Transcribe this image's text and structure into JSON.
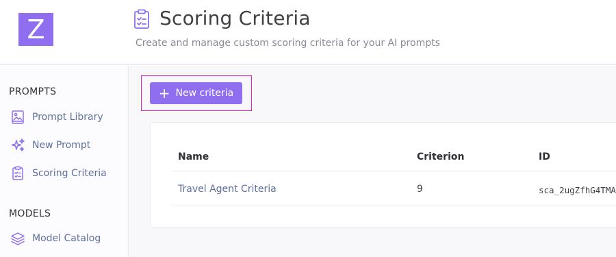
{
  "header": {
    "logo_letter": "Z",
    "title": "Scoring Criteria",
    "subtitle": "Create and manage custom scoring criteria for your AI prompts",
    "title_icon": "clipboard-list-icon"
  },
  "sidebar": {
    "sections": [
      {
        "title": "PROMPTS",
        "items": [
          {
            "label": "Prompt Library",
            "icon": "image-book-icon"
          },
          {
            "label": "New Prompt",
            "icon": "sparkles-icon"
          },
          {
            "label": "Scoring Criteria",
            "icon": "clipboard-list-icon"
          }
        ]
      },
      {
        "title": "MODELS",
        "items": [
          {
            "label": "Model Catalog",
            "icon": "layers-icon"
          }
        ]
      }
    ]
  },
  "main": {
    "new_button_label": "New criteria",
    "table": {
      "columns": [
        "Name",
        "Criterion",
        "ID"
      ],
      "rows": [
        {
          "name": "Travel Agent Criteria",
          "criterion": "9",
          "id": "sca_2ugZfhG4TMA"
        }
      ]
    }
  },
  "colors": {
    "accent": "#8f6ef0",
    "highlight_border": "#e41fd0",
    "link": "#5f6f9e"
  }
}
